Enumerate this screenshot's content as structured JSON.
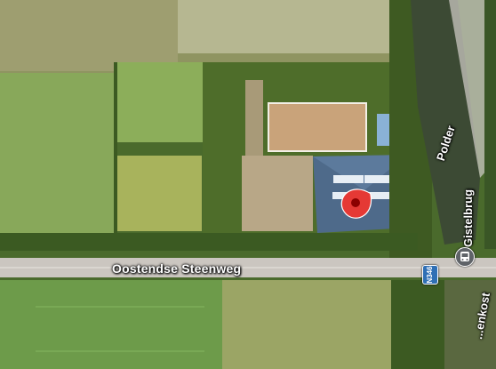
{
  "map": {
    "view": "satellite",
    "roads": [
      {
        "name": "Oostendse Steenweg",
        "route": "N346"
      },
      {
        "name": "Polder"
      },
      {
        "name": "Gistelbrug"
      },
      {
        "name": "...enkost"
      }
    ],
    "labels": {
      "main_road": "Oostendse Steenweg",
      "polder": "Polder",
      "gistelbrug": "Gistelbrug",
      "kost": "...enkost"
    },
    "route_shield": "N346",
    "markers": [
      {
        "type": "location-pin",
        "color": "#e53935"
      },
      {
        "type": "bus-stop-icon",
        "color": "#5f6368"
      }
    ]
  }
}
